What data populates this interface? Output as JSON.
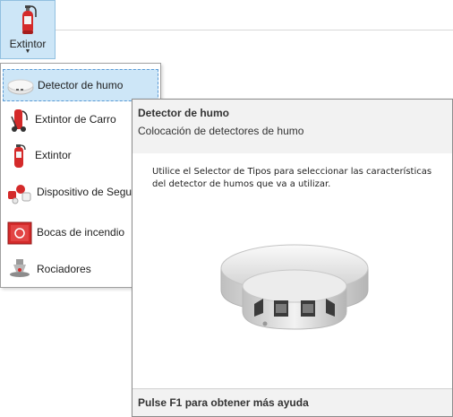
{
  "ribbon": {
    "button_label": "Extintor",
    "icon": "fire-extinguisher-icon"
  },
  "menu": {
    "items": [
      {
        "label": "Detector de humo",
        "icon": "smoke-detector-icon",
        "selected": true
      },
      {
        "label": "Extintor de Carro",
        "icon": "wheeled-extinguisher-icon"
      },
      {
        "label": "Extintor",
        "icon": "fire-extinguisher-icon"
      },
      {
        "label": "Dispositivo de Segu",
        "icon": "safety-device-icon"
      },
      {
        "label": "Bocas de incendio",
        "icon": "fire-hydrant-cabinet-icon"
      },
      {
        "label": "Rociadores",
        "icon": "sprinkler-icon"
      }
    ]
  },
  "tooltip": {
    "title": "Detector de humo",
    "subtitle": "Colocación de detectores de humo",
    "body": "Utilice el Selector de Tipos para seleccionar las características del detector de humos que va a utilizar.",
    "image": "smoke-detector-image",
    "footer": "Pulse F1 para obtener más ayuda"
  },
  "colors": {
    "selected_bg": "#cde6f7",
    "selected_border": "#5b9bd5",
    "extinguisher_red": "#d42a2a"
  }
}
